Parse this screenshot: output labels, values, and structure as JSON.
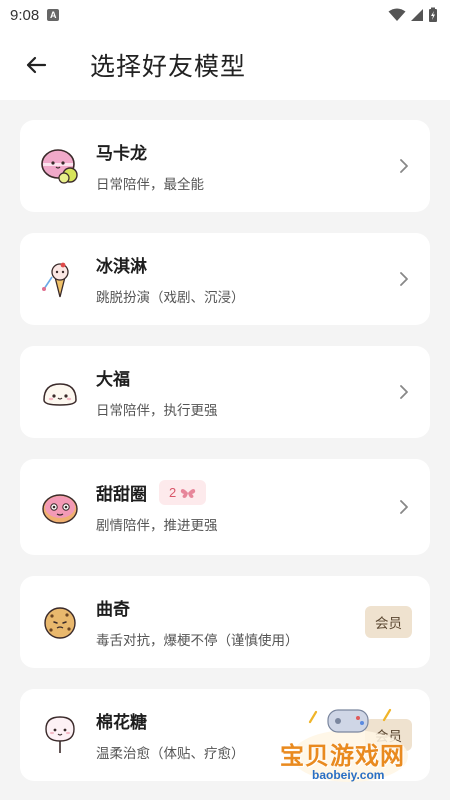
{
  "status_bar": {
    "time": "9:08",
    "indicator": "A"
  },
  "header": {
    "title": "选择好友模型"
  },
  "models": [
    {
      "name": "马卡龙",
      "description": "日常陪伴，最全能",
      "icon": "macaron-icon",
      "action": "chevron"
    },
    {
      "name": "冰淇淋",
      "description": "跳脱扮演（戏剧、沉浸）",
      "icon": "ice-cream-icon",
      "action": "chevron"
    },
    {
      "name": "大福",
      "description": "日常陪伴，执行更强",
      "icon": "daifuku-icon",
      "action": "chevron"
    },
    {
      "name": "甜甜圈",
      "description": "剧情陪伴，推进更强",
      "icon": "donut-icon",
      "action": "chevron",
      "tag": "2"
    },
    {
      "name": "曲奇",
      "description": "毒舌对抗，爆梗不停（谨慎使用）",
      "icon": "cookie-icon",
      "action": "member",
      "member_label": "会员"
    },
    {
      "name": "棉花糖",
      "description": "温柔治愈（体贴、疗愈）",
      "icon": "cotton-candy-icon",
      "action": "member",
      "member_label": "会员"
    }
  ],
  "watermark": {
    "text": "宝贝游戏网",
    "url": "baobeiy.com"
  },
  "colors": {
    "background": "#f4f4f4",
    "card": "#ffffff",
    "tag_bg": "#fdeaec",
    "tag_text": "#d9576a",
    "member_bg": "#efe2cf"
  }
}
